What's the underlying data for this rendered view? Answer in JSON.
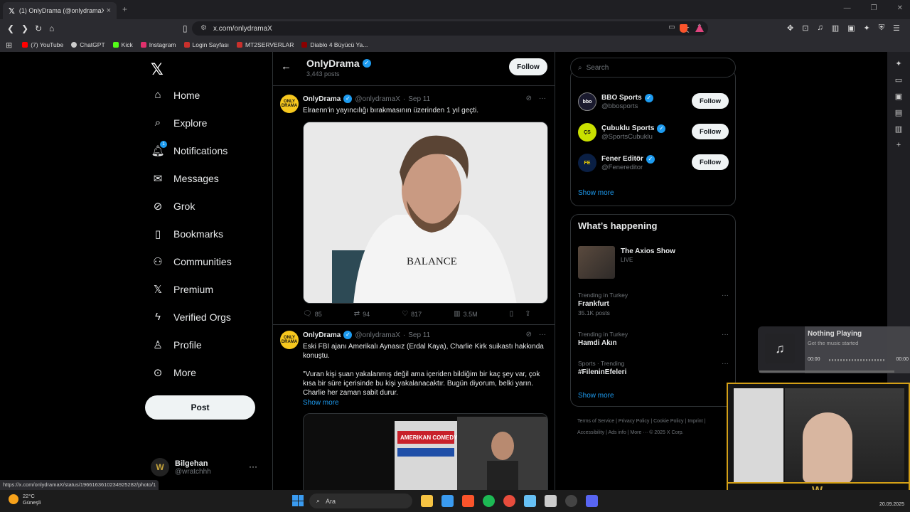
{
  "browser": {
    "tab_title": "(1) OnlyDrama (@onlydramaX) /",
    "tab_close": "×",
    "new_tab": "+",
    "url": "x.com/onlydramaX",
    "bookmarks": [
      {
        "label": "(7) YouTube",
        "color": "#ff0000"
      },
      {
        "label": "ChatGPT",
        "color": "#cccccc"
      },
      {
        "label": "Kick",
        "color": "#53fc18"
      },
      {
        "label": "Instagram",
        "color": "#e1306c"
      },
      {
        "label": "Login Sayfası",
        "color": "#c9302c"
      },
      {
        "label": "MT2SERVERLAR",
        "color": "#c9302c"
      },
      {
        "label": "Diablo 4 Büyücü Ya...",
        "color": "#8b0000"
      }
    ],
    "status_url": "https://x.com/onlydramaX/status/1966163610234925282/photo/1"
  },
  "nav": {
    "items": [
      {
        "label": "Home",
        "icon": "⌂"
      },
      {
        "label": "Explore",
        "icon": "⌕"
      },
      {
        "label": "Notifications",
        "icon": "🔔︎",
        "badge": "1"
      },
      {
        "label": "Messages",
        "icon": "✉"
      },
      {
        "label": "Grok",
        "icon": "⊘"
      },
      {
        "label": "Bookmarks",
        "icon": "▯"
      },
      {
        "label": "Communities",
        "icon": "⚇"
      },
      {
        "label": "Premium",
        "icon": "𝕏"
      },
      {
        "label": "Verified Orgs",
        "icon": "ϟ"
      },
      {
        "label": "Profile",
        "icon": "♙"
      },
      {
        "label": "More",
        "icon": "⊙"
      }
    ],
    "post_label": "Post",
    "account": {
      "name": "Bilgehan",
      "handle": "@wratchhh",
      "more": "···"
    }
  },
  "profile_header": {
    "name": "OnlyDrama",
    "posts": "3,443 posts",
    "follow_label": "Follow"
  },
  "tweets": [
    {
      "name": "OnlyDrama",
      "handle": "@onlydramaX",
      "date": "Sep 11",
      "text": "Elraenn'in yayıncılığı bırakmasının üzerinden 1 yıl geçti.",
      "image_text": "BALANCE",
      "stats": {
        "replies": "85",
        "reposts": "94",
        "likes": "817",
        "views": "3.5M"
      }
    },
    {
      "name": "OnlyDrama",
      "handle": "@onlydramaX",
      "date": "Sep 11",
      "text1": "Eski FBI ajanı Amerikalı Aynasız (Erdal Kaya), Charlie Kirk suikastı hakkında konuştu.",
      "text2": "\"Vuran kişi şuan yakalanmış değil ama içeriden bildiğim bir kaç şey var, çok kısa bir süre içerisinde bu kişi yakalanacaktır. Bugün diyorum, belki yarın. Charlie her zaman sabit durur.",
      "show_more": "Show more",
      "image_text": "AMERIKAN COMEDY"
    }
  ],
  "sidebar": {
    "search_placeholder": "Search",
    "who_to_follow": [
      {
        "name": "BBO Sports",
        "handle": "@bbosports",
        "follow": "Follow",
        "av": "bbo",
        "av_color": "#1a1a2e"
      },
      {
        "name": "Çubuklu Sports",
        "handle": "@SportsCubuklu",
        "follow": "Follow",
        "av": "ÇS",
        "av_color": "#c9e000"
      },
      {
        "name": "Fener Editör",
        "handle": "@Fenereditor",
        "follow": "Follow",
        "av": "FE",
        "av_color": "#0a1f44"
      }
    ],
    "show_more": "Show more",
    "happening_title": "What’s happening",
    "live": {
      "title": "The Axios Show",
      "status": "LIVE"
    },
    "trends": [
      {
        "category": "Trending in Turkey",
        "name": "Frankfurt",
        "count": "35.1K posts"
      },
      {
        "category": "Trending in Turkey",
        "name": "Hamdi Akın",
        "count": ""
      },
      {
        "category": "Sports · Trending",
        "name": "#FileninEfeleri",
        "count": ""
      }
    ],
    "show_more_2": "Show more",
    "footer": "Terms of Service  |  Privacy Policy  |  Cookie Policy  |  Imprint  |  Accessibility  |  Ads info  |  More ···  © 2025 X Corp."
  },
  "music": {
    "title": "Nothing Playing",
    "subtitle": "Get the music started",
    "time_left": "00:00",
    "time_right": "00:00"
  },
  "taskbar": {
    "temp": "22°C",
    "weather": "Güneşli",
    "search": "Ara",
    "date": "20.09.2025",
    "apps": [
      "#f6c343",
      "#3a9bf0",
      "#fb542b",
      "#1db954",
      "#e74c3c",
      "#66c0f4",
      "#cccccc",
      "#444444",
      "#5865f2"
    ]
  }
}
